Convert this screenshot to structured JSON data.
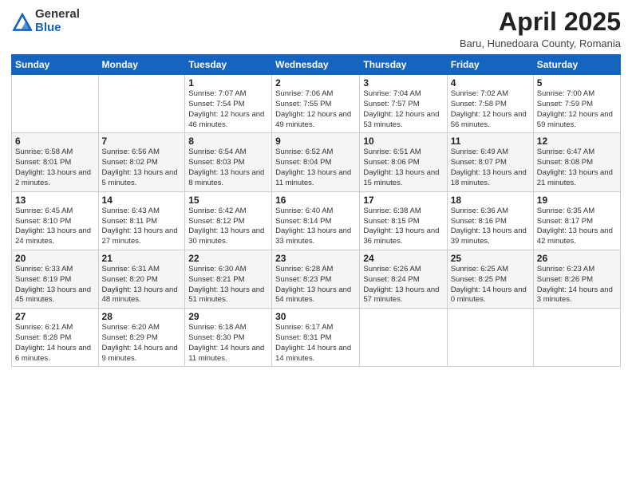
{
  "header": {
    "logo_general": "General",
    "logo_blue": "Blue",
    "month_year": "April 2025",
    "location": "Baru, Hunedoara County, Romania"
  },
  "weekdays": [
    "Sunday",
    "Monday",
    "Tuesday",
    "Wednesday",
    "Thursday",
    "Friday",
    "Saturday"
  ],
  "weeks": [
    [
      {
        "day": "",
        "info": ""
      },
      {
        "day": "",
        "info": ""
      },
      {
        "day": "1",
        "info": "Sunrise: 7:07 AM\nSunset: 7:54 PM\nDaylight: 12 hours and 46 minutes."
      },
      {
        "day": "2",
        "info": "Sunrise: 7:06 AM\nSunset: 7:55 PM\nDaylight: 12 hours and 49 minutes."
      },
      {
        "day": "3",
        "info": "Sunrise: 7:04 AM\nSunset: 7:57 PM\nDaylight: 12 hours and 53 minutes."
      },
      {
        "day": "4",
        "info": "Sunrise: 7:02 AM\nSunset: 7:58 PM\nDaylight: 12 hours and 56 minutes."
      },
      {
        "day": "5",
        "info": "Sunrise: 7:00 AM\nSunset: 7:59 PM\nDaylight: 12 hours and 59 minutes."
      }
    ],
    [
      {
        "day": "6",
        "info": "Sunrise: 6:58 AM\nSunset: 8:01 PM\nDaylight: 13 hours and 2 minutes."
      },
      {
        "day": "7",
        "info": "Sunrise: 6:56 AM\nSunset: 8:02 PM\nDaylight: 13 hours and 5 minutes."
      },
      {
        "day": "8",
        "info": "Sunrise: 6:54 AM\nSunset: 8:03 PM\nDaylight: 13 hours and 8 minutes."
      },
      {
        "day": "9",
        "info": "Sunrise: 6:52 AM\nSunset: 8:04 PM\nDaylight: 13 hours and 11 minutes."
      },
      {
        "day": "10",
        "info": "Sunrise: 6:51 AM\nSunset: 8:06 PM\nDaylight: 13 hours and 15 minutes."
      },
      {
        "day": "11",
        "info": "Sunrise: 6:49 AM\nSunset: 8:07 PM\nDaylight: 13 hours and 18 minutes."
      },
      {
        "day": "12",
        "info": "Sunrise: 6:47 AM\nSunset: 8:08 PM\nDaylight: 13 hours and 21 minutes."
      }
    ],
    [
      {
        "day": "13",
        "info": "Sunrise: 6:45 AM\nSunset: 8:10 PM\nDaylight: 13 hours and 24 minutes."
      },
      {
        "day": "14",
        "info": "Sunrise: 6:43 AM\nSunset: 8:11 PM\nDaylight: 13 hours and 27 minutes."
      },
      {
        "day": "15",
        "info": "Sunrise: 6:42 AM\nSunset: 8:12 PM\nDaylight: 13 hours and 30 minutes."
      },
      {
        "day": "16",
        "info": "Sunrise: 6:40 AM\nSunset: 8:14 PM\nDaylight: 13 hours and 33 minutes."
      },
      {
        "day": "17",
        "info": "Sunrise: 6:38 AM\nSunset: 8:15 PM\nDaylight: 13 hours and 36 minutes."
      },
      {
        "day": "18",
        "info": "Sunrise: 6:36 AM\nSunset: 8:16 PM\nDaylight: 13 hours and 39 minutes."
      },
      {
        "day": "19",
        "info": "Sunrise: 6:35 AM\nSunset: 8:17 PM\nDaylight: 13 hours and 42 minutes."
      }
    ],
    [
      {
        "day": "20",
        "info": "Sunrise: 6:33 AM\nSunset: 8:19 PM\nDaylight: 13 hours and 45 minutes."
      },
      {
        "day": "21",
        "info": "Sunrise: 6:31 AM\nSunset: 8:20 PM\nDaylight: 13 hours and 48 minutes."
      },
      {
        "day": "22",
        "info": "Sunrise: 6:30 AM\nSunset: 8:21 PM\nDaylight: 13 hours and 51 minutes."
      },
      {
        "day": "23",
        "info": "Sunrise: 6:28 AM\nSunset: 8:23 PM\nDaylight: 13 hours and 54 minutes."
      },
      {
        "day": "24",
        "info": "Sunrise: 6:26 AM\nSunset: 8:24 PM\nDaylight: 13 hours and 57 minutes."
      },
      {
        "day": "25",
        "info": "Sunrise: 6:25 AM\nSunset: 8:25 PM\nDaylight: 14 hours and 0 minutes."
      },
      {
        "day": "26",
        "info": "Sunrise: 6:23 AM\nSunset: 8:26 PM\nDaylight: 14 hours and 3 minutes."
      }
    ],
    [
      {
        "day": "27",
        "info": "Sunrise: 6:21 AM\nSunset: 8:28 PM\nDaylight: 14 hours and 6 minutes."
      },
      {
        "day": "28",
        "info": "Sunrise: 6:20 AM\nSunset: 8:29 PM\nDaylight: 14 hours and 9 minutes."
      },
      {
        "day": "29",
        "info": "Sunrise: 6:18 AM\nSunset: 8:30 PM\nDaylight: 14 hours and 11 minutes."
      },
      {
        "day": "30",
        "info": "Sunrise: 6:17 AM\nSunset: 8:31 PM\nDaylight: 14 hours and 14 minutes."
      },
      {
        "day": "",
        "info": ""
      },
      {
        "day": "",
        "info": ""
      },
      {
        "day": "",
        "info": ""
      }
    ]
  ]
}
